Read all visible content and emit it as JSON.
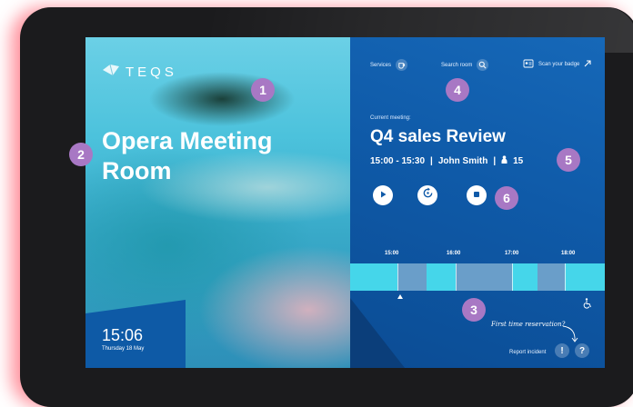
{
  "brand": {
    "logo_text": "TEQS"
  },
  "room": {
    "name": "Opera Meeting Room",
    "time": "15:06",
    "date": "Thursday 18 May"
  },
  "topbar": {
    "services_label": "Services",
    "search_label": "Search room",
    "badge_label": "Scan your badge"
  },
  "meeting": {
    "current_label": "Current meeting:",
    "title": "Q4 sales Review",
    "time_range": "15:00 - 15:30",
    "organizer": "John Smith",
    "separator": "|",
    "attendees": "15"
  },
  "timeline": {
    "hours": [
      "15:00",
      "16:00",
      "17:00",
      "18:00"
    ],
    "current_marker_hour": "15:06"
  },
  "footer": {
    "first_time_label": "First time reservation?",
    "report_label": "Report incident",
    "alert_glyph": "!",
    "help_glyph": "?"
  },
  "callouts": [
    "1",
    "2",
    "3",
    "4",
    "5",
    "6"
  ],
  "colors": {
    "accent": "#a878c4",
    "panel": "#0f5aa8",
    "free_slot": "#45d6ea",
    "busy_slot": "#6a9ec9"
  },
  "icons": [
    "teqs-logo-icon",
    "coffee-icon",
    "search-icon",
    "badge-scan-icon",
    "arrow-up-right-icon",
    "person-icon",
    "play-icon",
    "extend-icon",
    "stop-icon",
    "accessibility-icon",
    "curved-arrow-icon"
  ]
}
